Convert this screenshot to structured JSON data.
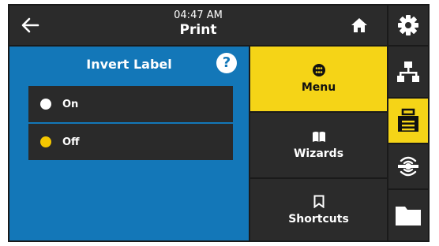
{
  "header": {
    "time": "04:47 AM",
    "title": "Print"
  },
  "setting": {
    "title": "Invert Label",
    "help_symbol": "?",
    "options": [
      {
        "label": "On",
        "selected": false,
        "radio_color": "#ffffff"
      },
      {
        "label": "Off",
        "selected": true,
        "radio_color": "#f5c700"
      }
    ]
  },
  "menu": {
    "items": [
      {
        "label": "Menu",
        "icon": "dots-grid-icon",
        "active": true
      },
      {
        "label": "Wizards",
        "icon": "book-icon",
        "active": false
      },
      {
        "label": "Shortcuts",
        "icon": "bookmark-icon",
        "active": false
      }
    ]
  },
  "sidebar": {
    "items": [
      {
        "icon": "gear-icon",
        "active": false
      },
      {
        "icon": "network-icon",
        "active": false
      },
      {
        "icon": "printer-icon",
        "active": true
      },
      {
        "icon": "connectivity-icon",
        "active": false
      },
      {
        "icon": "folder-icon",
        "active": false
      }
    ]
  },
  "colors": {
    "accent": "#f5d417",
    "panel": "#1377b8",
    "dark": "#2b2b2b",
    "selected_radio": "#f5c700"
  }
}
